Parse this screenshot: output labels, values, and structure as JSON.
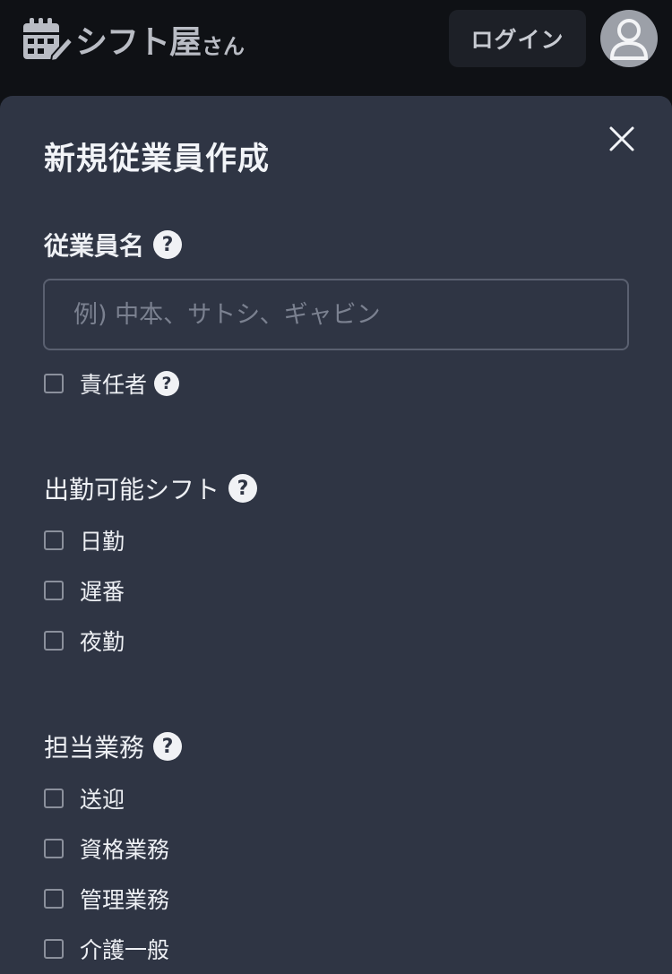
{
  "header": {
    "logo_text": "シフト屋",
    "logo_suffix": "さん",
    "login_label": "ログイン"
  },
  "modal": {
    "title": "新規従業員作成",
    "employee_name": {
      "label": "従業員名",
      "placeholder": "例) 中本、サトシ、ギャビン",
      "value": ""
    },
    "manager_checkbox": {
      "label": "責任者",
      "checked": false
    },
    "available_shifts": {
      "label": "出勤可能シフト",
      "options": [
        {
          "label": "日勤",
          "checked": false
        },
        {
          "label": "遅番",
          "checked": false
        },
        {
          "label": "夜勤",
          "checked": false
        }
      ]
    },
    "duties": {
      "label": "担当業務",
      "options": [
        {
          "label": "送迎",
          "checked": false
        },
        {
          "label": "資格業務",
          "checked": false
        },
        {
          "label": "管理業務",
          "checked": false
        },
        {
          "label": "介護一般",
          "checked": false
        }
      ]
    },
    "help_icon_text": "?"
  },
  "icons": {
    "logo": "calendar-pencil-icon",
    "close": "close-icon",
    "help": "question-circle-icon",
    "avatar": "user-icon"
  },
  "colors": {
    "background": "#0f1115",
    "modal": "#2f3544",
    "login_button": "#1d2027",
    "logo": "#b9bcc4",
    "avatar": "#9ca0a8"
  }
}
